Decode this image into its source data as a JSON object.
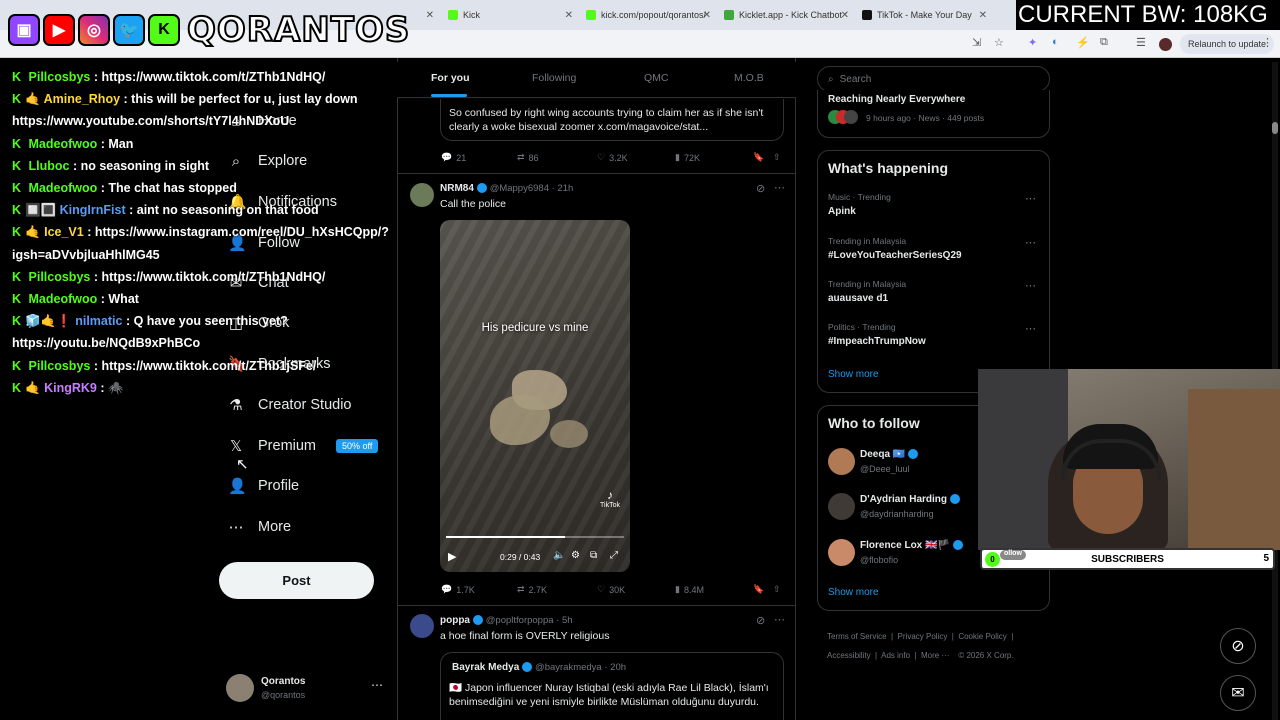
{
  "browser": {
    "tabs": [
      {
        "title": "",
        "favicon_color": "#8a8a8a"
      },
      {
        "title": "Kick",
        "favicon_color": "#53fc18"
      },
      {
        "title": "kick.com/popout/qorantos/",
        "favicon_color": "#53fc18"
      },
      {
        "title": "Kicklet.app - Kick Chatbot",
        "favicon_color": "#3fa83a"
      },
      {
        "title": "TikTok - Make Your Day",
        "favicon_color": "#111111"
      }
    ],
    "relaunch_label": "Relaunch to update"
  },
  "overlay": {
    "brand": "QORANTOS",
    "bandwidth": "CURRENT BW: 108KG",
    "subscribers_label": "SUBSCRIBERS",
    "subscribers_left": "0",
    "subscribers_right": "5",
    "follow_tag": "ollow"
  },
  "chat": {
    "messages": [
      {
        "user": "Pillcosbys",
        "user_color": "#53fc18",
        "badges": "",
        "text": ": https://www.tiktok.com/t/ZThb1NdHQ/"
      },
      {
        "user": "Amine_Rhoy",
        "user_color": "#ffd83a",
        "badges": "🤙",
        "text": ": this will be perfect for u, just lay down https://www.youtube.com/shorts/tY7l4hNDXoU"
      },
      {
        "user": "Madeofwoo",
        "user_color": "#53fc18",
        "badges": "",
        "text": ": Man"
      },
      {
        "user": "Lluboc",
        "user_color": "#53fc18",
        "badges": "",
        "text": ": no seasoning in sight"
      },
      {
        "user": "Madeofwoo",
        "user_color": "#53fc18",
        "badges": "",
        "text": ": The chat has stopped"
      },
      {
        "user": "KingIrnFist",
        "user_color": "#5b9cf2",
        "badges": "🔲🔳",
        "text": ": aint no seasoning on that food"
      },
      {
        "user": "Ice_V1",
        "user_color": "#ffd83a",
        "badges": "🤙",
        "text": ": https://www.instagram.com/reel/DU_hXsHCQpp/?igsh=aDVvbjluaHhlMG45"
      },
      {
        "user": "Pillcosbys",
        "user_color": "#53fc18",
        "badges": "",
        "text": ": https://www.tiktok.com/t/ZThb1NdHQ/"
      },
      {
        "user": "Madeofwoo",
        "user_color": "#53fc18",
        "badges": "",
        "text": ": What"
      },
      {
        "user": "nilmatic",
        "user_color": "#5b9cf2",
        "badges": "🧊🤙❗",
        "text": ": Q have you seen this yet? https://youtu.be/NQdB9xPhBCo"
      },
      {
        "user": "Pillcosbys",
        "user_color": "#53fc18",
        "badges": "",
        "text": ": https://www.tiktok.com/t/ZThb1jSFe/"
      },
      {
        "user": "KingRK9",
        "user_color": "#c77dff",
        "badges": "🤙",
        "text": ": 🕷️"
      }
    ]
  },
  "left_nav": {
    "items": [
      {
        "label": "Home",
        "icon": "home-icon",
        "glyph": "⌂"
      },
      {
        "label": "Explore",
        "icon": "search-icon",
        "glyph": "⌕"
      },
      {
        "label": "Notifications",
        "icon": "bell-icon",
        "glyph": "🔔"
      },
      {
        "label": "Follow",
        "icon": "follow-icon",
        "glyph": "👤"
      },
      {
        "label": "Chat",
        "icon": "mail-icon",
        "glyph": "✉"
      },
      {
        "label": "Grok",
        "icon": "grok-icon",
        "glyph": "◫"
      },
      {
        "label": "Bookmarks",
        "icon": "bookmark-icon",
        "glyph": "🔖"
      },
      {
        "label": "Creator Studio",
        "icon": "studio-icon",
        "glyph": "⚗"
      },
      {
        "label": "Premium",
        "icon": "x-logo-icon",
        "glyph": "𝕏"
      },
      {
        "label": "Profile",
        "icon": "profile-icon",
        "glyph": "👤"
      },
      {
        "label": "More",
        "icon": "more-icon",
        "glyph": "⋯"
      }
    ],
    "premium_badge": "50% off",
    "post_button": "Post",
    "account_name": "Qorantos",
    "account_handle": "@qorantos"
  },
  "feed": {
    "tabs": [
      "For you",
      "Following",
      "QMC",
      "M.O.B"
    ],
    "post0": {
      "text": "So confused by right wing accounts trying to claim her as if she isn't clearly a woke bisexual zoomer x.com/magavoice/stat...",
      "replies": "21",
      "reposts": "86",
      "likes": "3.2K",
      "views": "72K"
    },
    "post1": {
      "name": "NRM84",
      "handle": "@Mappy6984 · 21h",
      "text": "Call the police",
      "video_caption": "His pedicure vs mine",
      "video_watermark": "TikTok",
      "video_time": "0:29 / 0:43",
      "video_progress": 0.67,
      "replies": "1.7K",
      "reposts": "2.7K",
      "likes": "30K",
      "views": "8.4M"
    },
    "post2": {
      "name": "poppa",
      "handle": "@popltforpoppa · 5h",
      "text": "a hoe final form is OVERLY religious",
      "quote_name": "Bayrak Medya",
      "quote_handle": "@bayrakmedya · 20h",
      "quote_text": "🇯🇵 Japon influencer Nuray Istiqbal (eski adıyla Rae Lil Black), İslam'ı benimsediğini ve yeni ismiyle birlikte Müslüman olduğunu duyurdu."
    }
  },
  "right": {
    "search_placeholder": "Search",
    "top_item": {
      "title": "Reaching Nearly Everywhere",
      "meta": "9 hours ago · News · 449 posts"
    },
    "happening_title": "What's happening",
    "trends": [
      {
        "meta": "Music · Trending",
        "name": "Apink"
      },
      {
        "meta": "Trending in Malaysia",
        "name": "#LoveYouTeacherSeriesQ29"
      },
      {
        "meta": "Trending in Malaysia",
        "name": "auausave d1"
      },
      {
        "meta": "Politics · Trending",
        "name": "#ImpeachTrumpNow"
      }
    ],
    "show_more": "Show more",
    "who_title": "Who to follow",
    "who": [
      {
        "name": "Deeqa 🇸🇴",
        "handle": "@Deee_luul"
      },
      {
        "name": "D'Aydrian Harding",
        "handle": "@daydrianharding"
      },
      {
        "name": "Florence Lox 🇬🇧🏴",
        "handle": "@flobofio"
      }
    ],
    "footer": [
      "Terms of Service",
      "Privacy Policy",
      "Cookie Policy",
      "Accessibility",
      "Ads info",
      "More ···",
      "© 2026 X Corp."
    ]
  }
}
